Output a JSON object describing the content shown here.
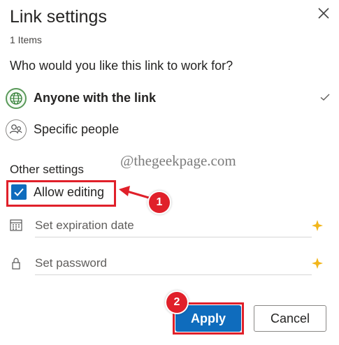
{
  "header": {
    "title": "Link settings",
    "item_count": "1 Items",
    "close_icon": "close-icon"
  },
  "audience": {
    "question": "Who would you like this link to work for?",
    "options": [
      {
        "label": "Anyone with the link",
        "icon": "globe-icon",
        "selected": true
      },
      {
        "label": "Specific people",
        "icon": "people-icon",
        "selected": false
      }
    ]
  },
  "other_settings": {
    "heading": "Other settings",
    "allow_editing": {
      "label": "Allow editing",
      "checked": true
    },
    "expiration": {
      "placeholder": "Set expiration date",
      "icon": "calendar-icon",
      "premium_icon": "sparkle-icon"
    },
    "password": {
      "placeholder": "Set password",
      "icon": "lock-icon",
      "premium_icon": "sparkle-icon"
    }
  },
  "watermark": "@thegeekpage.com",
  "annotations": {
    "badge1": "1",
    "badge2": "2",
    "color": "#e0202a"
  },
  "actions": {
    "apply_label": "Apply",
    "cancel_label": "Cancel"
  },
  "colors": {
    "accent": "#0f6cbd",
    "sparkle": "#f2b61b"
  }
}
